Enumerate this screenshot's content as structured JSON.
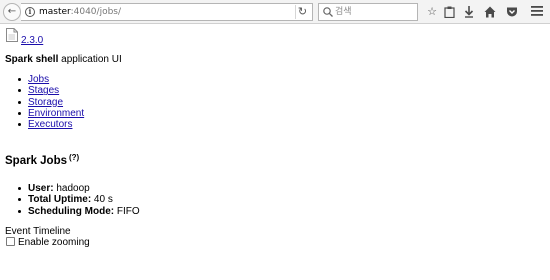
{
  "browser": {
    "url_host": "master",
    "url_rest": ":4040/jobs/",
    "search_placeholder": "검색"
  },
  "spark": {
    "version": "2.3.0",
    "app_name": "Spark shell",
    "app_suffix": " application UI",
    "nav": [
      {
        "label": "Jobs"
      },
      {
        "label": "Stages"
      },
      {
        "label": "Storage"
      },
      {
        "label": "Environment"
      },
      {
        "label": "Executors"
      }
    ],
    "title": "Spark Jobs",
    "help": "(?)",
    "info": [
      {
        "key": "User:",
        "value": " hadoop"
      },
      {
        "key": "Total Uptime:",
        "value": " 40 s"
      },
      {
        "key": "Scheduling Mode:",
        "value": " FIFO"
      }
    ],
    "timeline_label": "Event Timeline",
    "zoom_label": "Enable zooming"
  }
}
